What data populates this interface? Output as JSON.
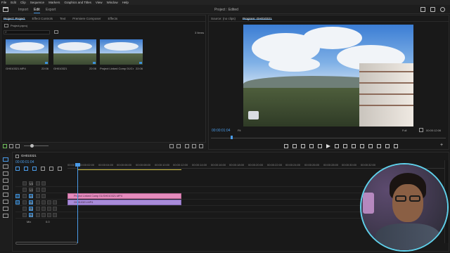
{
  "menu": [
    "File",
    "Edit",
    "Clip",
    "Sequence",
    "Markers",
    "Graphics and Titles",
    "View",
    "Window",
    "Help"
  ],
  "workspace_tabs": [
    "Import",
    "Edit",
    "Export"
  ],
  "project_title": "Project : Edited",
  "project_panel": {
    "tabs": [
      "Project: Project",
      "Effect Controls",
      "Text",
      "Premiere Composer",
      "Effects"
    ],
    "file": "Project.prproj",
    "search_placeholder": "",
    "item_count": "3 Items",
    "items": [
      {
        "name": "GH010321.MP4",
        "duration": "22:06"
      },
      {
        "name": "GH010321",
        "duration": "22:06"
      },
      {
        "name": "Project Linked Comp 01/Cre...",
        "duration": "22:06"
      }
    ]
  },
  "program": {
    "tabs": [
      "Source: (no clips)",
      "Program: GH010321"
    ],
    "timecode": "00:00:01:04",
    "zoom": "Fit",
    "quality": "Full",
    "duration": "00:00:12:06"
  },
  "timeline": {
    "tab": "GH010321",
    "timecode": "00:00:01:04",
    "ruler": [
      "00:00",
      "00:00:02:00",
      "00:00:04:00",
      "00:00:06:00",
      "00:00:08:00",
      "00:00:10:00",
      "00:00:12:00",
      "00:00:14:00",
      "00:00:16:00",
      "00:00:18:00",
      "00:00:20:00",
      "00:00:22:00",
      "00:00:24:00",
      "00:00:26:00",
      "00:00:28:00",
      "00:00:30:00",
      "00:00:32:00"
    ],
    "video_tracks": [
      "V3",
      "V2",
      "V1"
    ],
    "audio_tracks": [
      "A1",
      "A2",
      "A3"
    ],
    "mix_label": "Mix",
    "mix_value": "0.0",
    "clip_video": "Project Linked Comp 01/GH010321.MP4",
    "clip_audio": "GH010321.MP4"
  },
  "colors": {
    "accent": "#3d8fd9",
    "clip_pink": "#e58bbd",
    "clip_purple": "#a88bd9",
    "webcam_ring": "#5fd0ea"
  }
}
